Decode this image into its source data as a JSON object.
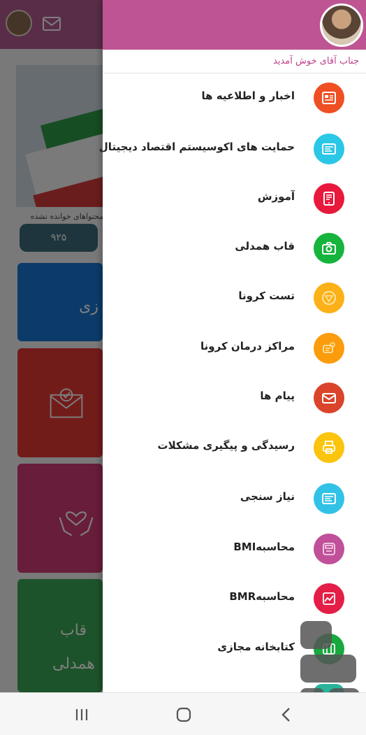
{
  "background_app": {
    "unread_label": "محتواهای خوانده نشده",
    "unread_count": "۹۲۵",
    "tile_blue_text": "زی",
    "tile_green_text": "قاب همدلی"
  },
  "drawer": {
    "welcome": "جناب آقای خوش آمدید",
    "items": [
      {
        "label": "اخبار و اطلاعیه ها",
        "icon": "news-icon",
        "color": "#f04e23"
      },
      {
        "label": "حمایت های اکوسیستم اقتصاد دیجیتال",
        "icon": "support-card-icon",
        "color": "#2bc7e6"
      },
      {
        "label": "آموزش",
        "icon": "tablet-learning-icon",
        "color": "#e8193c"
      },
      {
        "label": "قاب همدلی",
        "icon": "camera-icon",
        "color": "#16b43c"
      },
      {
        "label": "تست کرونا",
        "icon": "test-badge-icon",
        "color": "#fbb117"
      },
      {
        "label": "مراکز درمان کرونا",
        "icon": "hospital-card-icon",
        "color": "#fb9c0c"
      },
      {
        "label": "پیام ها",
        "icon": "envelope-icon",
        "color": "#d9442a"
      },
      {
        "label": "رسیدگی و پیگیری مشکلات",
        "icon": "printer-icon",
        "color": "#fbc40d"
      },
      {
        "label": "نیاز سنجی",
        "icon": "survey-card-icon",
        "color": "#32c2e8"
      },
      {
        "label": "محاسبهBMI",
        "icon": "scale-icon",
        "color": "#c0509a"
      },
      {
        "label": "محاسبهBMR",
        "icon": "chart-icon",
        "color": "#e41e46"
      },
      {
        "label": "کتابخانه مجازی",
        "icon": "library-icon",
        "color": "#18a83e"
      }
    ]
  },
  "navbar": {
    "recents": "recents-icon",
    "home": "home-icon",
    "back": "back-icon"
  }
}
